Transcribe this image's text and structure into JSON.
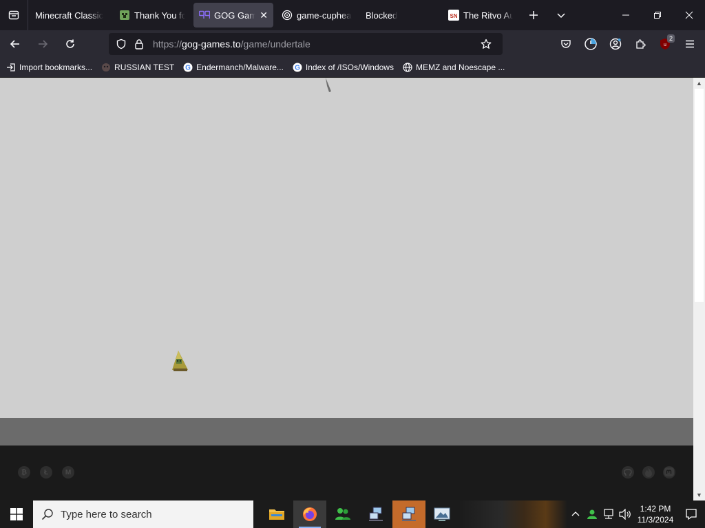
{
  "browser": {
    "tabs": [
      {
        "title": "Minecraft Classic",
        "icon": "none",
        "active": false
      },
      {
        "title": "Thank You for",
        "icon": "creeper-icon",
        "active": false
      },
      {
        "title": "GOG Games",
        "icon": "gog-icon",
        "active": true
      },
      {
        "title": "game-cuphea",
        "icon": "spiral-icon",
        "active": false
      },
      {
        "title": "Blocked",
        "icon": "none",
        "active": false
      },
      {
        "title": "The Ritvo Auti",
        "icon": "sn-icon",
        "active": false
      }
    ],
    "sn_label": "SN",
    "url": {
      "scheme": "https://",
      "host": "gog-games.to",
      "path": "/game/undertale"
    },
    "extension_badge": "2",
    "bookmarks": [
      {
        "label": "Import bookmarks...",
        "icon": "import-icon"
      },
      {
        "label": "RUSSIAN TEST",
        "icon": "mask-icon"
      },
      {
        "label": "Endermanch/Malware...",
        "icon": "google-icon"
      },
      {
        "label": "Index of /ISOs/Windows",
        "icon": "google-icon"
      },
      {
        "label": "MEMZ and Noescape ...",
        "icon": "globe-icon"
      }
    ]
  },
  "page": {
    "background_color": "#cfcfcf",
    "band_color": "#6b6b6b",
    "footer_color": "#1a1a1a"
  },
  "taskbar": {
    "search_placeholder": "Type here to search",
    "apps": [
      {
        "name": "file-explorer-icon"
      },
      {
        "name": "firefox-icon"
      },
      {
        "name": "people-icon"
      },
      {
        "name": "network-setup-icon"
      },
      {
        "name": "network-setup-icon"
      },
      {
        "name": "screenshot-app-icon"
      }
    ],
    "clock": {
      "time": "1:42 PM",
      "date": "11/3/2024"
    }
  }
}
